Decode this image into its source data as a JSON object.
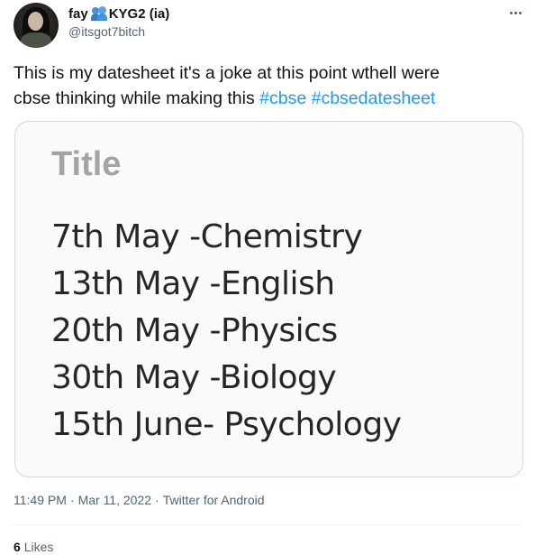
{
  "tweet": {
    "author": {
      "display_name": "fay",
      "display_name_suffix": "KYG2 (ia)",
      "handle": "@itsgot7bitch",
      "avatar_icon": "profile-photo",
      "badge_icon": "people-hugging-emoji"
    },
    "text": {
      "line1": "This is my datesheet it's a joke at this point wthell were",
      "line2_prefix": "cbse thinking while making this ",
      "hashtags": [
        "#cbse",
        "#cbsedatesheet"
      ]
    },
    "media": {
      "title": "Title",
      "rows": [
        "7th May -Chemistry",
        "13th May -English",
        "20th May -Physics",
        "30th May -Biology",
        "15th June- Psychology"
      ]
    },
    "meta": {
      "time": "11:49 PM",
      "separator": "·",
      "date": "Mar 11, 2022",
      "source": "Twitter for Android"
    },
    "engagement": {
      "likes_count": "6",
      "likes_label": "Likes"
    }
  },
  "colors": {
    "text_primary": "#0f1419",
    "text_secondary": "#536471",
    "link": "#1d9bf0",
    "border": "#cfd9de"
  }
}
